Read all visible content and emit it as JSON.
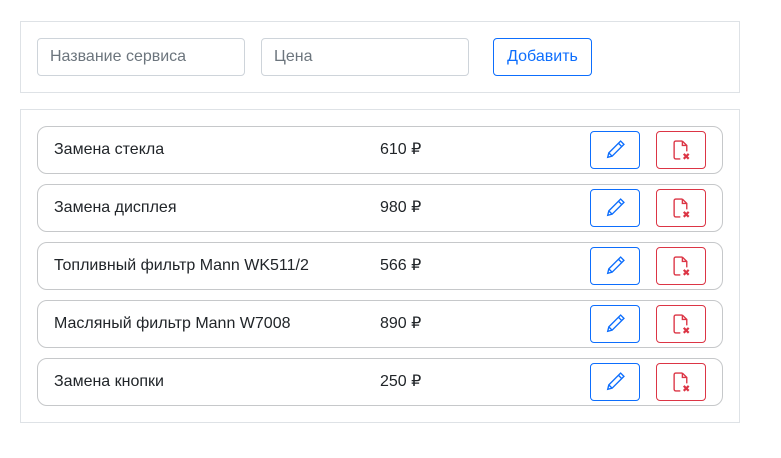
{
  "form": {
    "name_placeholder": "Название сервиса",
    "price_placeholder": "Цена",
    "add_label": "Добавить"
  },
  "services": [
    {
      "name": "Замена стекла",
      "price": "610 ₽"
    },
    {
      "name": "Замена дисплея",
      "price": "980 ₽"
    },
    {
      "name": "Топливный фильтр Mann WK511/2",
      "price": "566 ₽"
    },
    {
      "name": "Масляный фильтр Mann W7008",
      "price": "890 ₽"
    },
    {
      "name": "Замена кнопки",
      "price": "250 ₽"
    }
  ],
  "icons": {
    "edit": "pencil-icon",
    "delete": "file-x-icon"
  },
  "colors": {
    "primary": "#0d6efd",
    "danger": "#dc3545",
    "border": "#dee2e6"
  }
}
